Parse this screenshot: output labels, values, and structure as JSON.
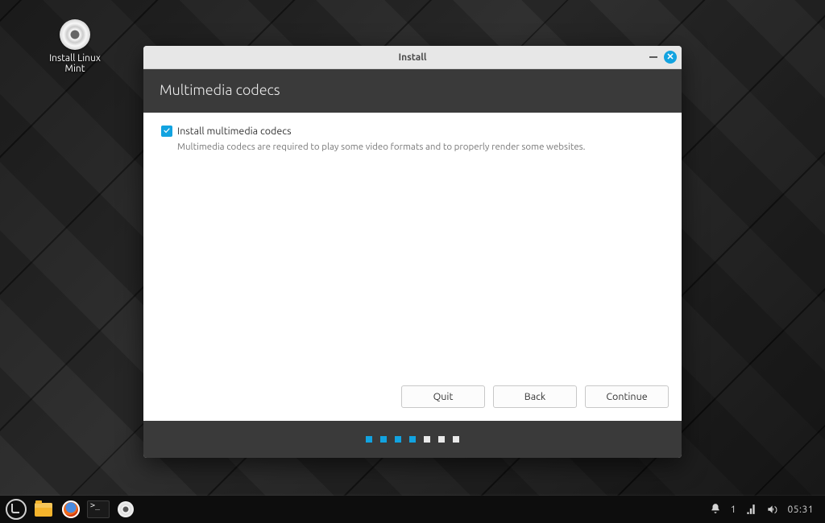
{
  "desktop": {
    "icon_label": "Install Linux Mint"
  },
  "installer": {
    "window_title": "Install",
    "page_heading": "Multimedia codecs",
    "checkbox_label": "Install multimedia codecs",
    "checkbox_checked": true,
    "description": "Multimedia codecs are required to play some video formats and to properly render some websites.",
    "buttons": {
      "quit": "Quit",
      "back": "Back",
      "continue": "Continue"
    },
    "progress": {
      "total_steps": 7,
      "completed_steps": 4
    }
  },
  "panel": {
    "notification_count": "1",
    "clock": "05:31"
  }
}
